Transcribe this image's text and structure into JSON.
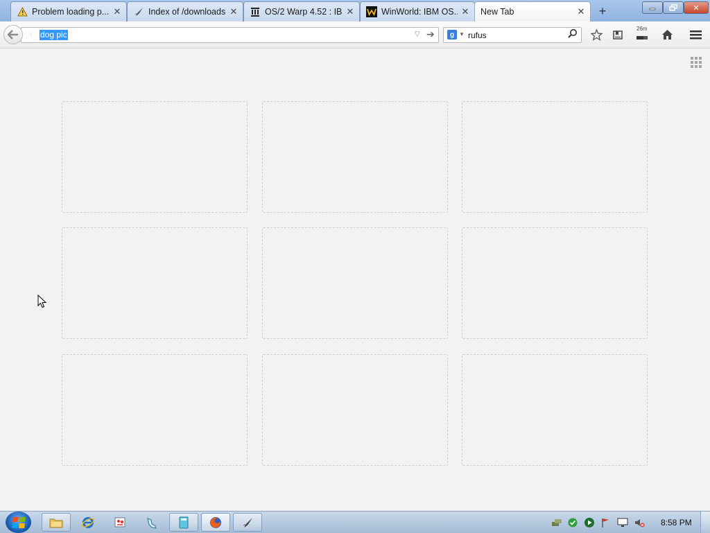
{
  "tabs": [
    {
      "label": "Problem loading p...",
      "icon": "warning-icon"
    },
    {
      "label": "Index of /downloads",
      "icon": "rocket-icon"
    },
    {
      "label": "OS/2 Warp 4.52 : IB...",
      "icon": "archive-icon"
    },
    {
      "label": "WinWorld: IBM OS...",
      "icon": "winworld-icon"
    },
    {
      "label": "New Tab",
      "icon": "",
      "active": true
    }
  ],
  "address_bar": {
    "value": "dog pic"
  },
  "search_bar": {
    "engine": "g",
    "value": "rufus"
  },
  "toolbar": {
    "downloads_badge": "26m"
  },
  "taskbar": {
    "items": [
      "start-button",
      "file-explorer",
      "internet-explorer",
      "paint",
      "paw-app",
      "calculator",
      "firefox",
      "rocket-app"
    ],
    "clock": "8:58 PM"
  },
  "colors": {
    "accent_selection": "#3399ff",
    "content_bg": "#f2f2f2",
    "tile_border": "#cfcfcf"
  }
}
